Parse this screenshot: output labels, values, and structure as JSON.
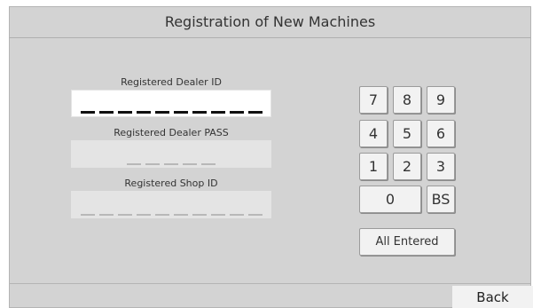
{
  "header": {
    "title": "Registration of New Machines"
  },
  "fields": {
    "dealer_id": {
      "label": "Registered Dealer ID",
      "length": 10
    },
    "dealer_pass": {
      "label": "Registered Dealer PASS",
      "length": 5
    },
    "shop_id": {
      "label": "Registered Shop ID",
      "length": 10
    }
  },
  "keypad": {
    "k7": "7",
    "k8": "8",
    "k9": "9",
    "k4": "4",
    "k5": "5",
    "k6": "6",
    "k1": "1",
    "k2": "2",
    "k3": "3",
    "k0": "0",
    "bs": "BS",
    "all_entered": "All Entered"
  },
  "footer": {
    "back_label": "Back"
  }
}
